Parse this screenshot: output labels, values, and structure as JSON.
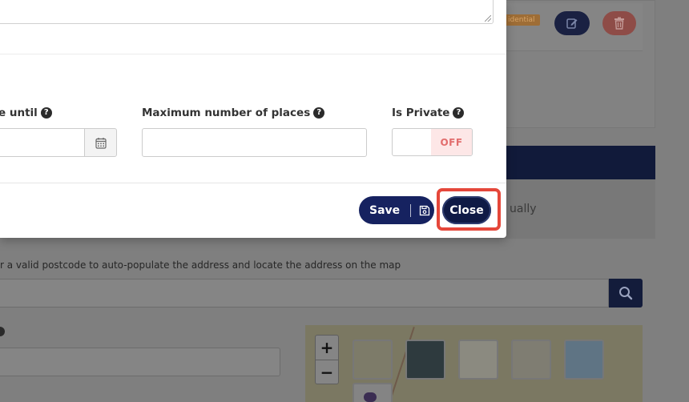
{
  "background": {
    "badge_text": "idential",
    "manually_text": "ually",
    "postcode_hint": "r a valid postcode to auto-populate the address and locate the address on the map",
    "map": {
      "zoom_in": "+",
      "zoom_out": "−"
    }
  },
  "modal": {
    "fields": {
      "available_until_label": "e until",
      "max_places_label": "Maximum number of places",
      "max_places_value": "",
      "is_private_label": "Is Private",
      "is_private_state": "OFF"
    },
    "footer": {
      "save_label": "Save",
      "close_label": "Close"
    }
  },
  "colors": {
    "primary_navy": "#162260",
    "close_navy": "#0f1a45",
    "highlight_red": "#e5473a",
    "toggle_off_bg": "#fde7e7",
    "toggle_off_text": "#e26d6d"
  },
  "icons": {
    "help": "question-circle-icon",
    "calendar": "calendar-icon",
    "save": "floppy-disk-icon",
    "search": "search-icon",
    "edit": "pencil-square-icon",
    "delete": "trash-icon"
  }
}
